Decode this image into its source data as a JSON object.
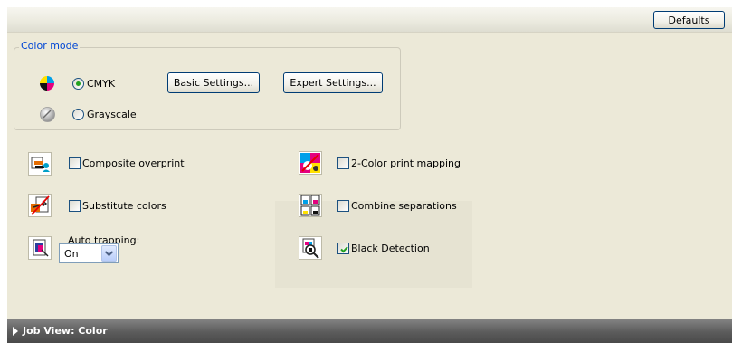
{
  "toolbar": {
    "defaults_label": "Defaults"
  },
  "color_mode": {
    "title": "Color mode",
    "cmyk_label": "CMYK",
    "cmyk_selected": true,
    "grayscale_label": "Grayscale",
    "grayscale_selected": false,
    "basic_settings_label": "Basic Settings...",
    "expert_settings_label": "Expert Settings..."
  },
  "options": {
    "composite_overprint": {
      "label": "Composite overprint",
      "checked": false
    },
    "substitute_colors": {
      "label": "Substitute colors",
      "checked": false
    },
    "two_color_print_mapping": {
      "label": "2-Color print mapping",
      "checked": false
    },
    "combine_separations": {
      "label": "Combine separations",
      "checked": false
    },
    "black_detection": {
      "label": "Black Detection",
      "checked": true
    }
  },
  "auto_trapping": {
    "label": "Auto trapping:",
    "value": "On"
  },
  "footer": {
    "label": "Job View: Color"
  },
  "colors": {
    "group_title": "#0046d5",
    "panel_bg": "#ece9d8",
    "check_green": "#21a121",
    "footer_bg": "#5c5c5c"
  }
}
